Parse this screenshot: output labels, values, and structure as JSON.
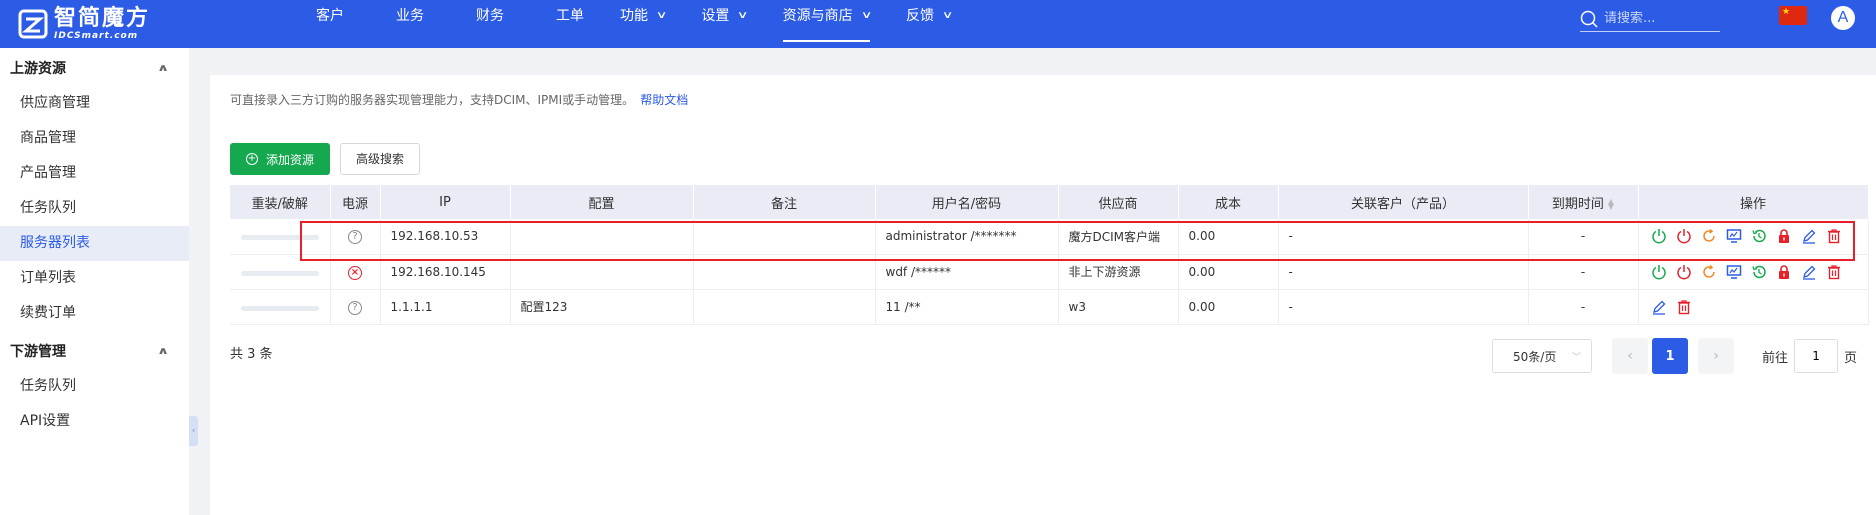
{
  "brand": {
    "name_cn": "智简魔方",
    "name_en": "IDCSmart.com"
  },
  "nav": {
    "items": [
      {
        "label": "客户",
        "has_dropdown": false,
        "active": false
      },
      {
        "label": "业务",
        "has_dropdown": false,
        "active": false
      },
      {
        "label": "财务",
        "has_dropdown": false,
        "active": false
      },
      {
        "label": "工单",
        "has_dropdown": false,
        "active": false
      },
      {
        "label": "功能",
        "has_dropdown": true,
        "active": false
      },
      {
        "label": "设置",
        "has_dropdown": true,
        "active": false
      },
      {
        "label": "资源与商店",
        "has_dropdown": true,
        "active": true
      },
      {
        "label": "反馈",
        "has_dropdown": true,
        "active": false
      }
    ],
    "search_placeholder": "请搜索...",
    "avatar_letter": "A"
  },
  "sidebar": {
    "groups": [
      {
        "title": "上游资源",
        "items": [
          {
            "label": "供应商管理",
            "active": false
          },
          {
            "label": "商品管理",
            "active": false
          },
          {
            "label": "产品管理",
            "active": false
          },
          {
            "label": "任务队列",
            "active": false
          },
          {
            "label": "服务器列表",
            "active": true
          },
          {
            "label": "订单列表",
            "active": false
          },
          {
            "label": "续费订单",
            "active": false
          }
        ]
      },
      {
        "title": "下游管理",
        "items": [
          {
            "label": "任务队列",
            "active": false
          },
          {
            "label": "API设置",
            "active": false
          }
        ]
      }
    ]
  },
  "main": {
    "description": "可直接录入三方订购的服务器实现管理能力，支持DCIM、IPMI或手动管理。",
    "help_link": "帮助文档",
    "add_button": "添加资源",
    "advanced_search_button": "高级搜索",
    "table": {
      "headers": [
        "重装/破解",
        "电源",
        "IP",
        "配置",
        "备注",
        "用户名/密码",
        "供应商",
        "成本",
        "关联客户（产品）",
        "到期时间",
        "操作"
      ],
      "rows": [
        {
          "power": "unknown",
          "ip": "192.168.10.53",
          "config": "",
          "note": "",
          "credentials": "administrator /*******",
          "supplier": "魔方DCIM客户端",
          "cost": "0.00",
          "customer": "-",
          "expire": "-",
          "actions": "full",
          "highlighted": true
        },
        {
          "power": "off",
          "ip": "192.168.10.145",
          "config": "",
          "note": "",
          "credentials": "wdf /******",
          "supplier": "非上下游资源",
          "cost": "0.00",
          "customer": "-",
          "expire": "-",
          "actions": "full",
          "highlighted": false
        },
        {
          "power": "unknown",
          "ip": "1.1.1.1",
          "config": "配置123",
          "note": "",
          "credentials": "11 /**",
          "supplier": "w3",
          "cost": "0.00",
          "customer": "-",
          "expire": "-",
          "actions": "basic",
          "highlighted": false
        }
      ]
    },
    "total": "共 3 条",
    "pagination": {
      "page_size": "50条/页",
      "current_page": "1",
      "goto_label": "前往",
      "goto_value": "1",
      "page_unit": "页"
    }
  },
  "colors": {
    "brand_blue": "#2c5be6",
    "add_green": "#16a84f",
    "highlight_red": "#e8202c",
    "action_green": "#16a84f",
    "action_red": "#e6212a",
    "action_orange": "#f08a24",
    "action_blue": "#2c5be6"
  }
}
